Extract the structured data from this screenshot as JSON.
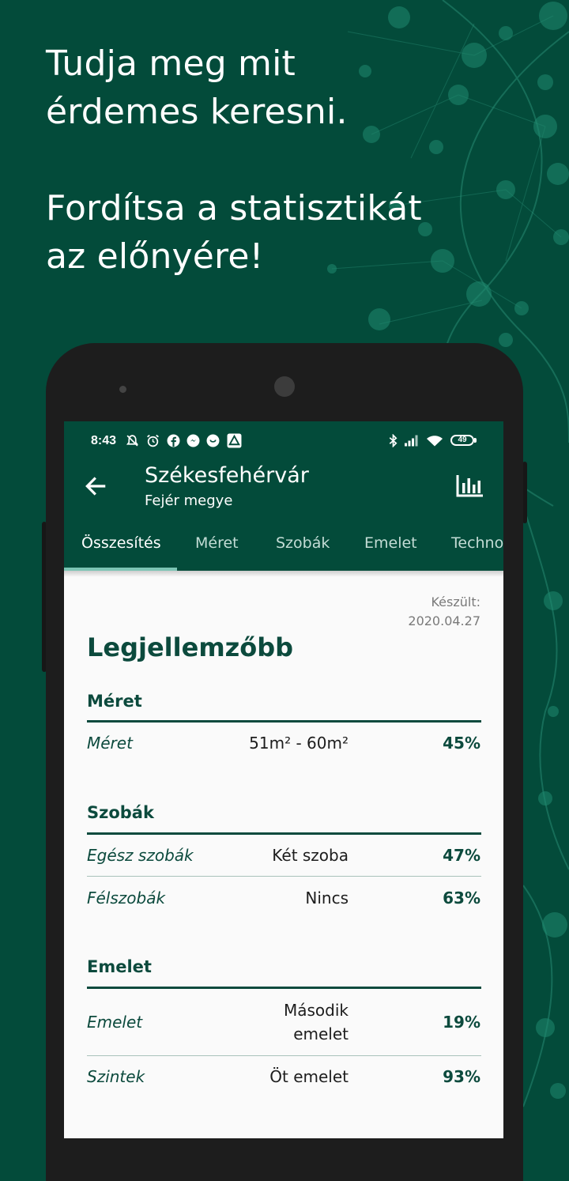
{
  "promo": {
    "line1": "Tudja meg mit",
    "line2": "érdemes keresni.",
    "line3": "Fordítsa a statisztikát",
    "line4": "az előnyére!"
  },
  "status_bar": {
    "time": "8:43",
    "battery": "49",
    "left_icons": [
      "mute-icon",
      "alarm-icon",
      "facebook-icon",
      "chat-icon",
      "app-icon",
      "drive-icon"
    ],
    "right_icons": [
      "bluetooth-icon",
      "signal-icon",
      "wifi-icon",
      "battery-icon"
    ]
  },
  "app_bar": {
    "title": "Székesfehérvár",
    "subtitle": "Fejér megye",
    "back_icon": "arrow-back-icon",
    "action_icon": "bar-chart-icon",
    "color": "#034b3a",
    "tab_indicator_color": "#7cc5b4"
  },
  "tabs": [
    "Összesítés",
    "Méret",
    "Szobák",
    "Emelet",
    "Techno"
  ],
  "active_tab": "Összesítés",
  "content": {
    "made_label": "Készült:",
    "made_date": "2020.04.27",
    "heading": "Legjellemzőbb",
    "sections": [
      {
        "title": "Méret",
        "rows": [
          {
            "label": "Méret",
            "value": "51m² - 60m²",
            "pct": "45%"
          }
        ]
      },
      {
        "title": "Szobák",
        "rows": [
          {
            "label": "Egész szobák",
            "value": "Két szoba",
            "pct": "47%"
          },
          {
            "label": "Félszobák",
            "value": "Nincs",
            "pct": "63%"
          }
        ]
      },
      {
        "title": "Emelet",
        "rows": [
          {
            "label": "Emelet",
            "value_line1": "Második",
            "value_line2": "emelet",
            "pct": "19%"
          },
          {
            "label": "Szintek",
            "value": "Öt emelet",
            "pct": "93%"
          }
        ]
      }
    ]
  }
}
